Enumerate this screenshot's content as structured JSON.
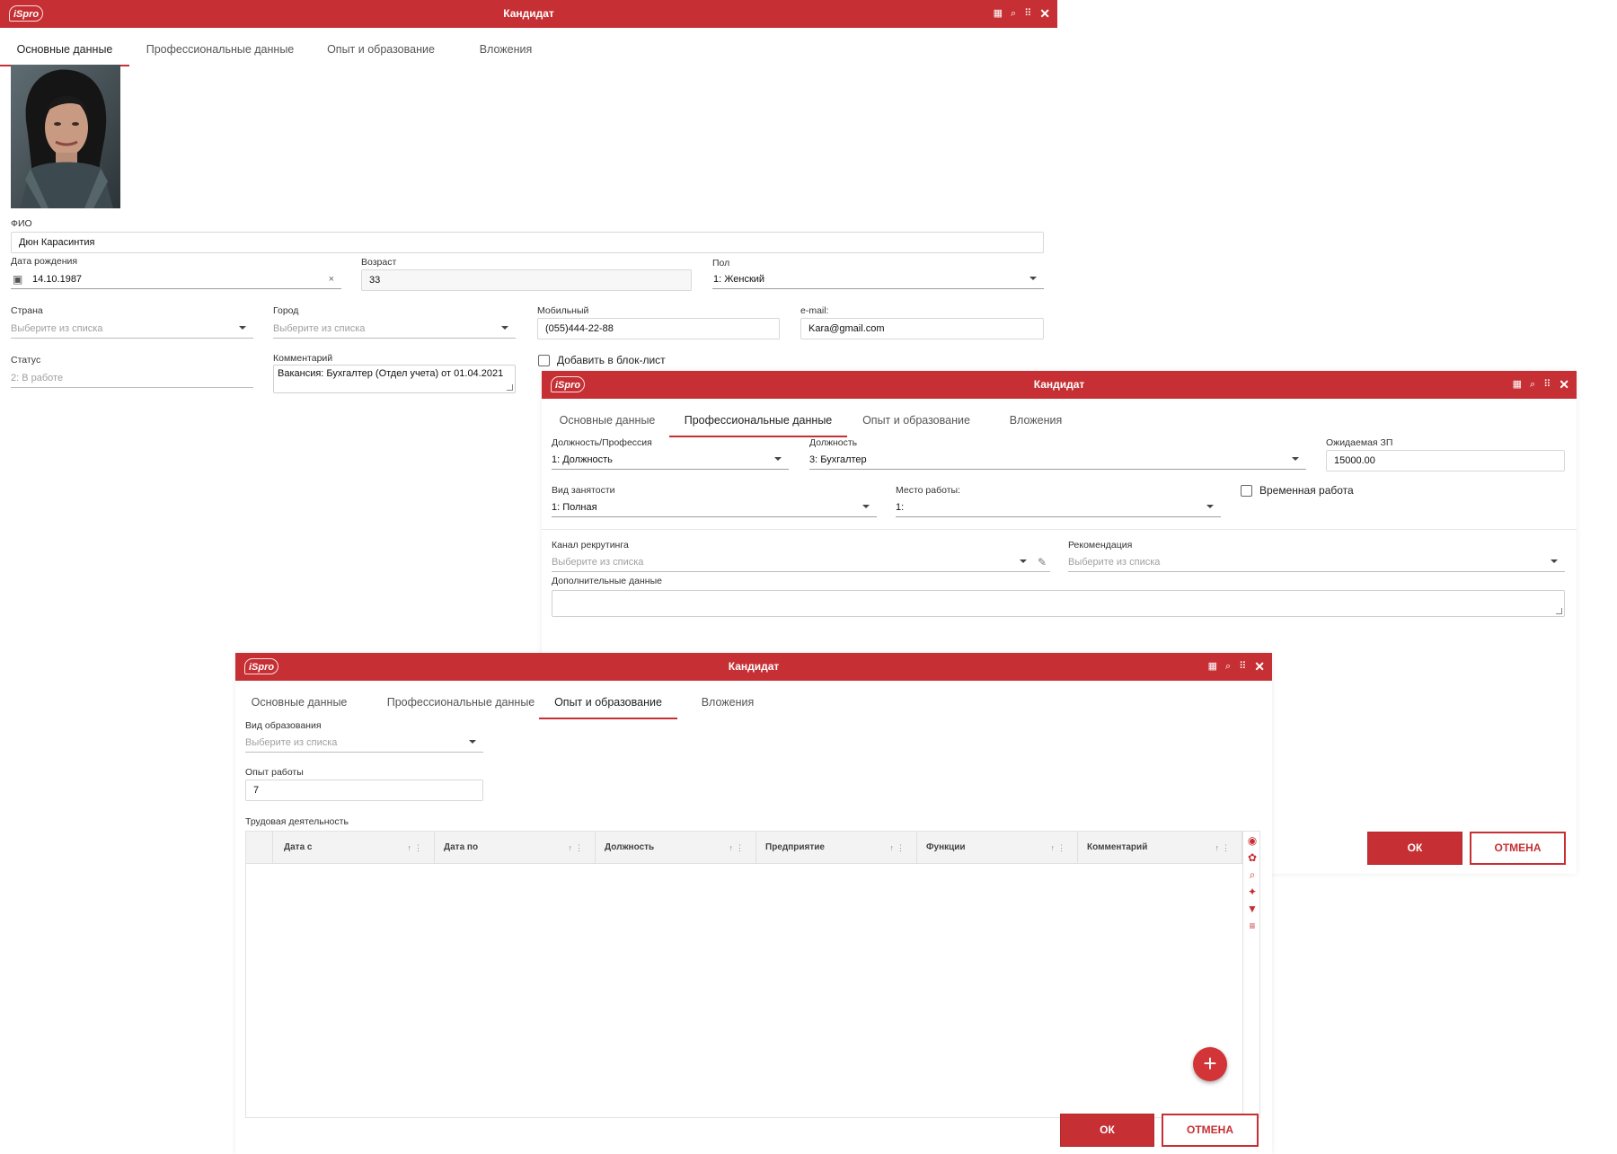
{
  "theme": {
    "accent": "#c62f33"
  },
  "window1": {
    "logo": "iSpro",
    "title": "Кандидат",
    "tabs": [
      "Основные данные",
      "Профессиональные данные",
      "Опыт и образование",
      "Вложения"
    ],
    "fio_label": "ФИО",
    "fio_value": "Дюн Карасинтия",
    "birth_label": "Дата рождения",
    "birth_value": "14.10.1987",
    "age_label": "Возраст",
    "age_value": "33",
    "gender_label": "Пол",
    "gender_value": "1: Женский",
    "country_label": "Страна",
    "country_placeholder": "Выберите из списка",
    "city_label": "Город",
    "city_placeholder": "Выберите из списка",
    "mobile_label": "Мобильный",
    "mobile_value": "(055)444-22-88",
    "email_label": "e-mail:",
    "email_value": "Kara@gmail.com",
    "status_label": "Статус",
    "status_value": "2: В работе",
    "comment_label": "Комментарий",
    "comment_value": "Вакансия: Бухгалтер (Отдел учета) от 01.04.2021",
    "blocklist_label": "Добавить в блок-лист"
  },
  "window2": {
    "logo": "iSpro",
    "title": "Кандидат",
    "tabs": [
      "Основные данные",
      "Профессиональные данные",
      "Опыт и образование",
      "Вложения"
    ],
    "profession_label": "Должность/Профессия",
    "profession_value": "1: Должность",
    "position_label": "Должность",
    "position_value": "3: Бухгалтер",
    "salary_label": "Ожидаемая ЗП",
    "salary_value": "15000.00",
    "employment_label": "Вид занятости",
    "employment_value": "1: Полная",
    "workplace_label": "Место работы:",
    "workplace_value": "1:",
    "temp_label": "Временная работа",
    "channel_label": "Канал рекрутинга",
    "channel_placeholder": "Выберите из списка",
    "recommend_label": "Рекомендация",
    "recommend_placeholder": "Выберите из списка",
    "extra_label": "Дополнительные данные",
    "ok": "ОК",
    "cancel": "ОТМЕНА"
  },
  "window3": {
    "logo": "iSpro",
    "title": "Кандидат",
    "tabs": [
      "Основные данные",
      "Профессиональные данные",
      "Опыт и образование",
      "Вложения"
    ],
    "edu_label": "Вид образования",
    "edu_placeholder": "Выберите из списка",
    "exp_label": "Опыт работы",
    "exp_value": "7",
    "work_label": "Трудовая деятельность",
    "columns": [
      "Дата с",
      "Дата по",
      "Должность",
      "Предприятие",
      "Функции",
      "Комментарий"
    ],
    "side_icons": [
      "eye-icon",
      "palette-icon",
      "search-icon",
      "pin-icon",
      "filter-icon",
      "sort-icon"
    ],
    "ok": "ОК",
    "cancel": "ОТМЕНА"
  }
}
